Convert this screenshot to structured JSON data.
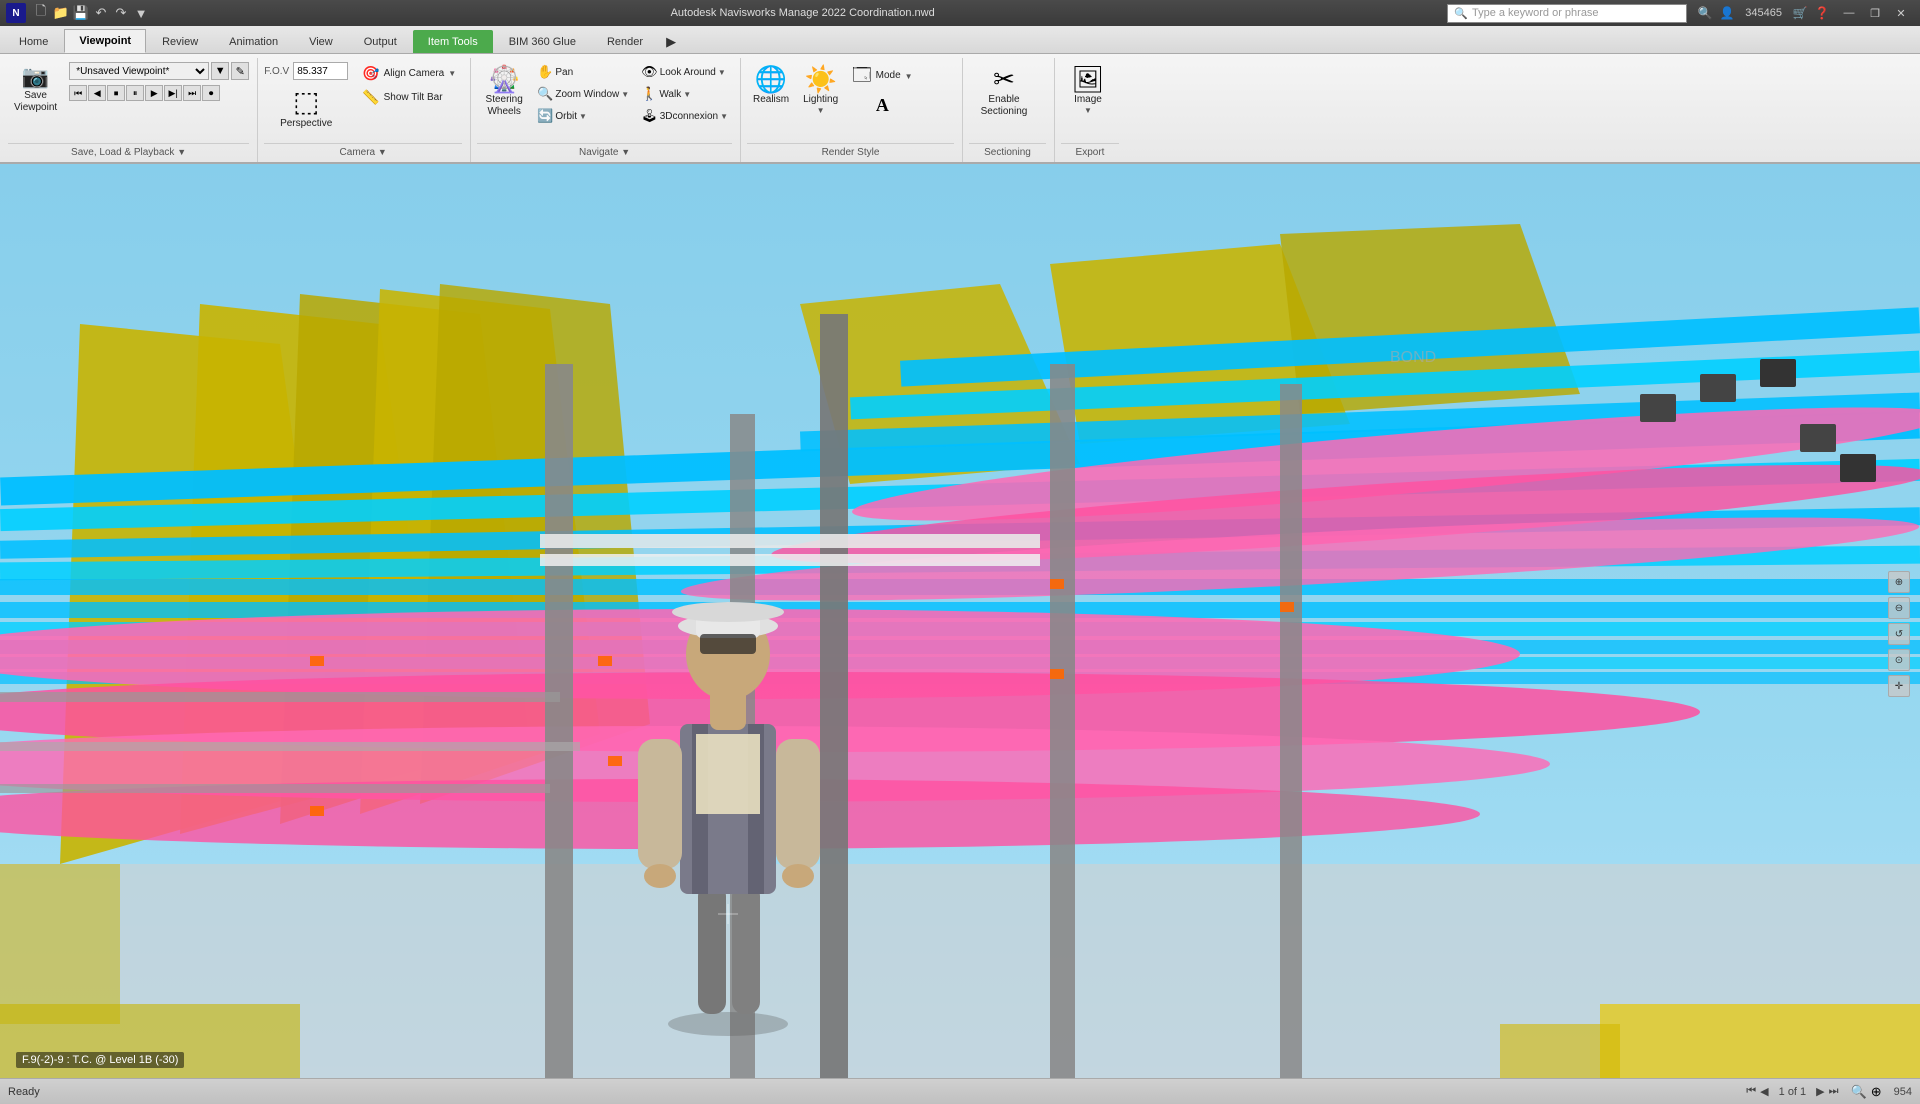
{
  "titlebar": {
    "app_icon": "N",
    "title": "Autodesk Navisworks Manage 2022    Coordination.nwd",
    "search_placeholder": "Type a keyword or phrase",
    "user_id": "345465",
    "window_controls": {
      "minimize": "—",
      "restore": "❐",
      "close": "✕"
    }
  },
  "quick_access": [
    "💾",
    "📁",
    "💾",
    "↶",
    "↷",
    "▶"
  ],
  "tabs": [
    {
      "id": "home",
      "label": "Home",
      "active": false
    },
    {
      "id": "viewpoint",
      "label": "Viewpoint",
      "active": true
    },
    {
      "id": "review",
      "label": "Review",
      "active": false
    },
    {
      "id": "animation",
      "label": "Animation",
      "active": false
    },
    {
      "id": "view",
      "label": "View",
      "active": false
    },
    {
      "id": "output",
      "label": "Output",
      "active": false
    },
    {
      "id": "item-tools",
      "label": "Item Tools",
      "active": false,
      "highlight": true
    },
    {
      "id": "bim360",
      "label": "BIM 360 Glue",
      "active": false
    },
    {
      "id": "render",
      "label": "Render",
      "active": false
    }
  ],
  "ribbon": {
    "sections": [
      {
        "id": "save-load",
        "label": "Save, Load & Playback",
        "tools_main": [
          {
            "icon": "📷",
            "label": "Save\nViewpoint"
          }
        ],
        "tools_sub": [
          {
            "label": "*Unsaved Viewpoint*",
            "type": "select"
          },
          {
            "label": "playback",
            "type": "playback"
          }
        ]
      },
      {
        "id": "camera",
        "label": "Camera",
        "fov_label": "F.O.V",
        "fov_value": "85.337",
        "tools": [
          {
            "icon": "⬛",
            "label": "Perspective",
            "big": true
          },
          {
            "icon": "🎯",
            "label": "Align Camera",
            "has_arrow": true
          },
          {
            "icon": "📏",
            "label": "Show Tilt Bar"
          }
        ]
      },
      {
        "id": "navigate",
        "label": "Navigate",
        "tools_big": [
          {
            "icon": "🎡",
            "label": "Steering\nWheels"
          }
        ],
        "tools_rows": [
          {
            "icon": "✋",
            "label": "Pan"
          },
          {
            "icon": "🔍",
            "label": "Zoom Window",
            "has_arrow": true
          },
          {
            "icon": "🔄",
            "label": "Orbit",
            "has_arrow": true
          },
          {
            "icon": "👁",
            "label": "Look Around",
            "has_arrow": true
          },
          {
            "icon": "🚶",
            "label": "Walk",
            "has_arrow": true
          },
          {
            "icon": "🕹",
            "label": "3Dconnexion",
            "has_arrow": true
          }
        ]
      },
      {
        "id": "render-style",
        "label": "Render Style",
        "tools": [
          {
            "icon": "💡",
            "label": "Realism"
          },
          {
            "icon": "☀️",
            "label": "Lighting"
          },
          {
            "icon": "🗔",
            "label": "Mode"
          },
          {
            "icon": "A",
            "label": "",
            "special": true
          }
        ]
      },
      {
        "id": "sectioning",
        "label": "Sectioning",
        "tools": [
          {
            "icon": "✂",
            "label": "Enable\nSectioning"
          }
        ]
      },
      {
        "id": "export",
        "label": "Export",
        "tools": [
          {
            "icon": "🖼",
            "label": "Image"
          }
        ]
      }
    ]
  },
  "viewport": {
    "coord_label": "F.9(-2)-9 : T.C. @ Level 1B (-30)",
    "right_controls": [
      "⊕",
      "⊖",
      "↺",
      "⊙",
      "✛"
    ]
  },
  "statusbar": {
    "ready": "Ready",
    "page": "1 of 1",
    "zoom": "954"
  }
}
